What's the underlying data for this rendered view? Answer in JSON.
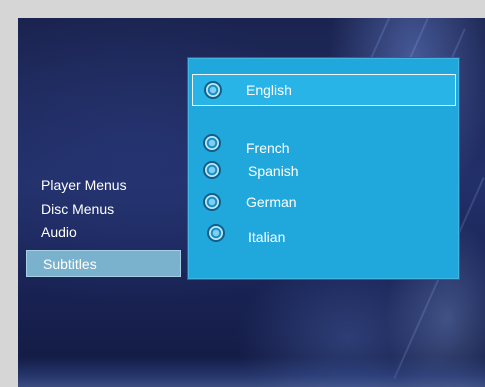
{
  "menu": {
    "items": [
      {
        "label": "Player Menus"
      },
      {
        "label": "Disc Menus"
      },
      {
        "label": "Audio"
      },
      {
        "label": "Subtitles"
      }
    ],
    "selected_index": 3
  },
  "subtitles_panel": {
    "options": [
      {
        "label": "English"
      },
      {
        "label": "French"
      },
      {
        "label": "Spanish"
      },
      {
        "label": "German"
      },
      {
        "label": "Italian"
      }
    ],
    "highlighted_index": 0
  },
  "colors": {
    "panel_background": "#20a8dc",
    "menu_selected": "#7ab1cc",
    "text": "#ffffff"
  }
}
